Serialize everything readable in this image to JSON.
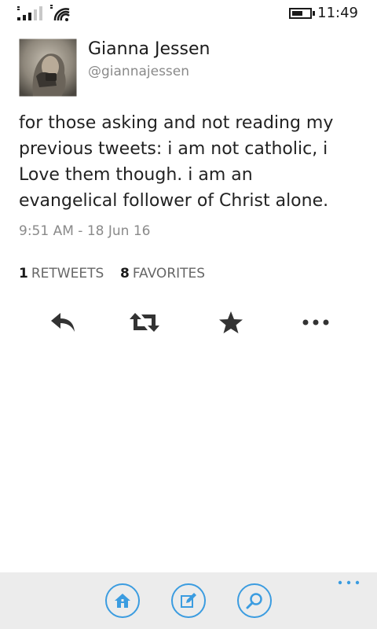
{
  "status_bar": {
    "time": "11:49",
    "icons": [
      "signal-strength-icon",
      "wifi-icon",
      "battery-icon"
    ]
  },
  "tweet": {
    "author": {
      "display_name": "Gianna Jessen",
      "handle": "@giannajessen"
    },
    "text": "for those asking and not reading my previous tweets: i am not catholic, i Love them though. i am an evangelical follower of Christ alone.",
    "timestamp": "9:51 AM - 18 Jun 16",
    "retweets": {
      "count": "1",
      "label": "RETWEETS"
    },
    "favorites": {
      "count": "8",
      "label": "FAVORITES"
    }
  },
  "actions": [
    "reply-icon",
    "retweet-icon",
    "favorite-star-icon",
    "more-options-icon"
  ],
  "app_bar": {
    "buttons": [
      "home-icon",
      "compose-icon",
      "search-icon"
    ],
    "accent_color": "#3b9ce0",
    "background_color": "#ececec"
  }
}
